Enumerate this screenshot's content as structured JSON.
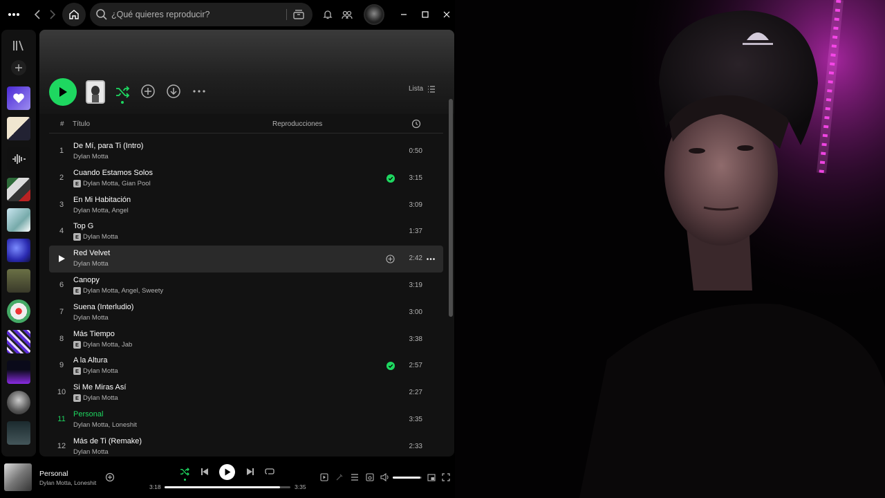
{
  "search": {
    "placeholder": "¿Qué quieres reproducir?"
  },
  "view": {
    "label": "Lista"
  },
  "list_header": {
    "num": "#",
    "title": "Título",
    "plays": "Reproducciones"
  },
  "tracks": [
    {
      "num": "1",
      "title": "De Mí, para Ti (Intro)",
      "artists": "Dylan Motta",
      "explicit": false,
      "saved": false,
      "duration": "0:50"
    },
    {
      "num": "2",
      "title": "Cuando Estamos Solos",
      "artists": "Dylan Motta, Gian Pool",
      "explicit": true,
      "saved": true,
      "duration": "3:15"
    },
    {
      "num": "3",
      "title": "En Mi Habitación",
      "artists": "Dylan Motta, Angel",
      "explicit": false,
      "saved": false,
      "duration": "3:09"
    },
    {
      "num": "4",
      "title": "Top G",
      "artists": "Dylan Motta",
      "explicit": true,
      "saved": false,
      "duration": "1:37"
    },
    {
      "num": "5",
      "title": "Red Velvet",
      "artists": "Dylan Motta",
      "explicit": false,
      "saved": false,
      "duration": "2:42"
    },
    {
      "num": "6",
      "title": "Canopy",
      "artists": "Dylan Motta, Angel, Sweety",
      "explicit": true,
      "saved": false,
      "duration": "3:19"
    },
    {
      "num": "7",
      "title": "Suena (Interludio)",
      "artists": "Dylan Motta",
      "explicit": false,
      "saved": false,
      "duration": "3:00"
    },
    {
      "num": "8",
      "title": "Más Tiempo",
      "artists": "Dylan Motta, Jab",
      "explicit": true,
      "saved": false,
      "duration": "3:38"
    },
    {
      "num": "9",
      "title": "A la Altura",
      "artists": "Dylan Motta",
      "explicit": true,
      "saved": true,
      "duration": "2:57"
    },
    {
      "num": "10",
      "title": "Si Me Miras Así",
      "artists": "Dylan Motta",
      "explicit": true,
      "saved": false,
      "duration": "2:27"
    },
    {
      "num": "11",
      "title": "Personal",
      "artists": "Dylan Motta, Loneshit",
      "explicit": false,
      "saved": false,
      "duration": "3:35"
    },
    {
      "num": "12",
      "title": "Más de Ti (Remake)",
      "artists": "Dylan Motta",
      "explicit": false,
      "saved": false,
      "duration": "2:33"
    }
  ],
  "hovered_track": "5",
  "playing_track": "11",
  "now_playing": {
    "title": "Personal",
    "artists": "Dylan Motta, Loneshit",
    "position": "3:18",
    "duration": "3:35",
    "progress": 0.92,
    "volume": 0.95,
    "shuffle": true
  },
  "colors": {
    "accent": "#1ed760",
    "background": "#121212",
    "text_secondary": "#b3b3b3"
  },
  "icons": [
    "menu-dots-icon",
    "back-icon",
    "forward-icon",
    "home-icon",
    "search-icon",
    "browse-icon",
    "bell-icon",
    "friends-icon",
    "library-icon",
    "plus-icon",
    "play-icon",
    "shuffle-icon",
    "add-circle-icon",
    "download-icon",
    "more-icon",
    "list-icon",
    "clock-icon",
    "check-icon",
    "prev-icon",
    "next-icon",
    "repeat-icon",
    "now-playing-view-icon",
    "lyrics-icon",
    "queue-icon",
    "device-icon",
    "volume-icon",
    "miniplayer-icon",
    "fullscreen-icon"
  ]
}
